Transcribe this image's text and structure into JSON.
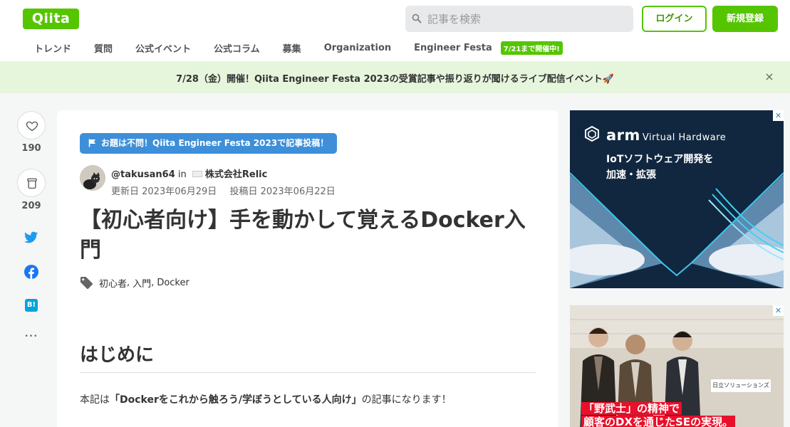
{
  "header": {
    "logo": "Qiita",
    "search_placeholder": "記事を検索",
    "login_label": "ログイン",
    "signup_label": "新規登録"
  },
  "nav": {
    "items": [
      "トレンド",
      "質問",
      "公式イベント",
      "公式コラム",
      "募集",
      "Organization",
      "Engineer Festa"
    ],
    "badge": "7/21まで開催中!"
  },
  "banner": {
    "text": "7/28（金）開催！Qiita Engineer Festa 2023の受賞記事や振り返りが聞けるライブ配信イベント🚀",
    "close": "×"
  },
  "rail": {
    "like_count": "190",
    "stock_count": "209",
    "more": "•••"
  },
  "article": {
    "event_tag": "お題は不問！Qiita Engineer Festa 2023で記事投稿！",
    "author_handle": "@takusan64",
    "author_in": "in",
    "organization": "株式会社Relic",
    "updated": "更新日 2023年06月29日",
    "posted": "投稿日 2023年06月22日",
    "title": "【初心者向け】手を動かして覚えるDocker入門",
    "tags": [
      "初心者",
      "入門",
      "Docker"
    ],
    "heading": "はじめに",
    "para_prefix": "本記は",
    "para_bold": "「Dockerをこれから触ろう/学ぼうとしている人向け」",
    "para_suffix": "の記事になります！"
  },
  "ads": {
    "ad1_brand": "arm",
    "ad1_brand_sub": "Virtual Hardware",
    "ad1_line1": "IoTソフトウェア開発を",
    "ad1_line2": "加速・拡張",
    "ad2_sign": "日立ソリューションズ",
    "ad2_caption_1": "「野武士」の精神で",
    "ad2_caption_2": "顧客のDXを通じたSEの実現。"
  },
  "colors": {
    "brand": "#55c500",
    "banner_bg": "#e6f6dc",
    "event_tag": "#3d8fd9",
    "twitter": "#1d9bf0",
    "facebook": "#1877f2",
    "hatena": "#00a4de"
  }
}
